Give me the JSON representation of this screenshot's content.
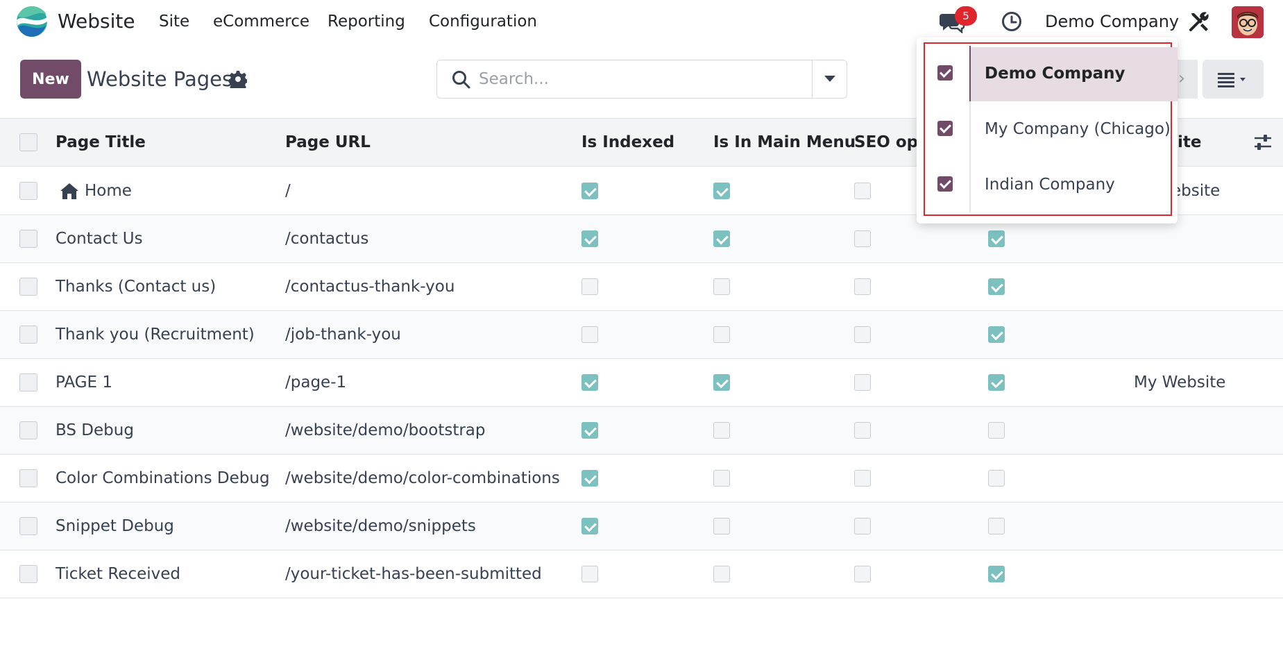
{
  "navbar": {
    "app_name": "Website",
    "menu": [
      "Site",
      "eCommerce",
      "Reporting",
      "Configuration"
    ],
    "messages_badge": "5",
    "company": "Demo Company"
  },
  "control_panel": {
    "new_label": "New",
    "title": "Website Pages",
    "search_placeholder": "Search..."
  },
  "columns": [
    "Page Title",
    "Page URL",
    "Is Indexed",
    "Is In Main Menu",
    "SEO opt",
    "ite"
  ],
  "rows": [
    {
      "title": "Home",
      "url": "/",
      "indexed": true,
      "main_menu": true,
      "seo": false,
      "published": null,
      "website": "ebsite"
    },
    {
      "title": "Contact Us",
      "url": "/contactus",
      "indexed": true,
      "main_menu": true,
      "seo": false,
      "published": true,
      "website": ""
    },
    {
      "title": "Thanks (Contact us)",
      "url": "/contactus-thank-you",
      "indexed": false,
      "main_menu": false,
      "seo": false,
      "published": true,
      "website": ""
    },
    {
      "title": "Thank you (Recruitment)",
      "url": "/job-thank-you",
      "indexed": false,
      "main_menu": false,
      "seo": false,
      "published": true,
      "website": ""
    },
    {
      "title": "PAGE 1",
      "url": "/page-1",
      "indexed": true,
      "main_menu": true,
      "seo": false,
      "published": true,
      "website": "My Website"
    },
    {
      "title": "BS Debug",
      "url": "/website/demo/bootstrap",
      "indexed": true,
      "main_menu": false,
      "seo": false,
      "published": false,
      "website": ""
    },
    {
      "title": "Color Combinations Debug",
      "url": "/website/demo/color-combinations",
      "indexed": true,
      "main_menu": false,
      "seo": false,
      "published": false,
      "website": ""
    },
    {
      "title": "Snippet Debug",
      "url": "/website/demo/snippets",
      "indexed": true,
      "main_menu": false,
      "seo": false,
      "published": false,
      "website": ""
    },
    {
      "title": "Ticket Received",
      "url": "/your-ticket-has-been-submitted",
      "indexed": false,
      "main_menu": false,
      "seo": false,
      "published": true,
      "website": ""
    }
  ],
  "company_dropdown": {
    "items": [
      {
        "label": "Demo Company",
        "checked": true,
        "active": true
      },
      {
        "label": "My Company (Chicago)",
        "checked": true,
        "active": false
      },
      {
        "label": "Indian Company",
        "checked": true,
        "active": false
      }
    ]
  },
  "colors": {
    "brand": "#714b67",
    "checkbox_checked": "#7cc0bf",
    "highlight_frame": "#e0262c",
    "badge": "#e0262c"
  }
}
